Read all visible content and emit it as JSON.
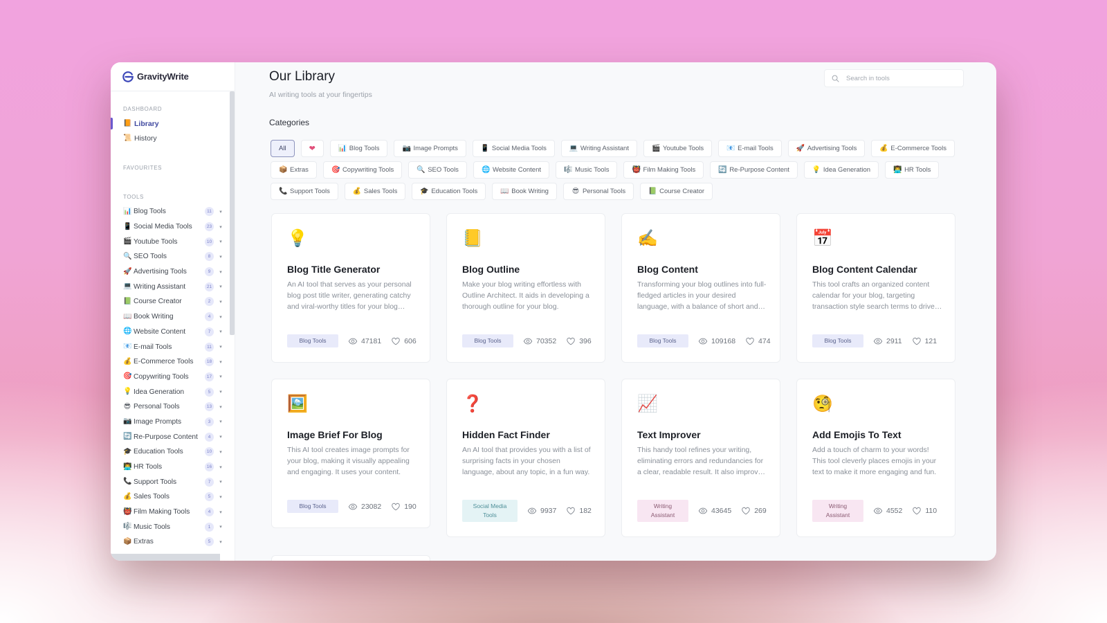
{
  "app": {
    "name": "GravityWrite"
  },
  "sidebar": {
    "dashboard_label": "DASHBOARD",
    "dashboard_items": [
      {
        "label": "Library",
        "emoji": "📙",
        "active": true
      },
      {
        "label": "History",
        "emoji": "📜",
        "active": false
      }
    ],
    "favourites_label": "FAVOURITES",
    "tools_label": "TOOLS",
    "tools": [
      {
        "label": "Blog Tools",
        "emoji": "📊",
        "count": "11"
      },
      {
        "label": "Social Media Tools",
        "emoji": "📱",
        "count": "23"
      },
      {
        "label": "Youtube Tools",
        "emoji": "🎬",
        "count": "10"
      },
      {
        "label": "SEO Tools",
        "emoji": "🔍",
        "count": "8"
      },
      {
        "label": "Advertising Tools",
        "emoji": "🚀",
        "count": "9"
      },
      {
        "label": "Writing Assistant",
        "emoji": "💻",
        "count": "21"
      },
      {
        "label": "Course Creator",
        "emoji": "📗",
        "count": "2"
      },
      {
        "label": "Book Writing",
        "emoji": "📖",
        "count": "4"
      },
      {
        "label": "Website Content",
        "emoji": "🌐",
        "count": "7"
      },
      {
        "label": "E-mail Tools",
        "emoji": "📧",
        "count": "11"
      },
      {
        "label": "E-Commerce Tools",
        "emoji": "💰",
        "count": "18"
      },
      {
        "label": "Copywriting Tools",
        "emoji": "🎯",
        "count": "17"
      },
      {
        "label": "Idea Generation",
        "emoji": "💡",
        "count": "5"
      },
      {
        "label": "Personal Tools",
        "emoji": "😎",
        "count": "13"
      },
      {
        "label": "Image Prompts",
        "emoji": "📷",
        "count": "3"
      },
      {
        "label": "Re-Purpose Content",
        "emoji": "🔄",
        "count": "4"
      },
      {
        "label": "Education Tools",
        "emoji": "🎓",
        "count": "10"
      },
      {
        "label": "HR Tools",
        "emoji": "👨‍💻",
        "count": "16"
      },
      {
        "label": "Support Tools",
        "emoji": "📞",
        "count": "7"
      },
      {
        "label": "Sales Tools",
        "emoji": "💰",
        "count": "5"
      },
      {
        "label": "Film Making Tools",
        "emoji": "👹",
        "count": "4"
      },
      {
        "label": "Music Tools",
        "emoji": "🎼",
        "count": "1"
      },
      {
        "label": "Extras",
        "emoji": "📦",
        "count": "5"
      }
    ]
  },
  "header": {
    "title": "Our Library",
    "subtitle": "AI writing tools at your fingertips",
    "search_placeholder": "Search in tools",
    "search_value": ""
  },
  "categories": {
    "label": "Categories",
    "rows": [
      [
        {
          "label": "All",
          "emoji": "",
          "active": true
        },
        {
          "label": "",
          "emoji": "❤",
          "favourite": true
        },
        {
          "label": "Blog Tools",
          "emoji": "📊"
        },
        {
          "label": "Image Prompts",
          "emoji": "📷"
        },
        {
          "label": "Social Media Tools",
          "emoji": "📱"
        },
        {
          "label": "Writing Assistant",
          "emoji": "💻"
        },
        {
          "label": "Youtube Tools",
          "emoji": "🎬"
        },
        {
          "label": "E-mail Tools",
          "emoji": "📧"
        },
        {
          "label": "Advertising Tools",
          "emoji": "🚀"
        },
        {
          "label": "E-Commerce Tools",
          "emoji": "💰"
        }
      ],
      [
        {
          "label": "Extras",
          "emoji": "📦"
        },
        {
          "label": "Copywriting Tools",
          "emoji": "🎯"
        },
        {
          "label": "SEO Tools",
          "emoji": "🔍"
        },
        {
          "label": "Website Content",
          "emoji": "🌐"
        },
        {
          "label": "Music Tools",
          "emoji": "🎼"
        },
        {
          "label": "Film Making Tools",
          "emoji": "👹"
        },
        {
          "label": "Re-Purpose Content",
          "emoji": "🔄"
        },
        {
          "label": "Idea Generation",
          "emoji": "💡"
        },
        {
          "label": "HR Tools",
          "emoji": "👨‍💻"
        }
      ],
      [
        {
          "label": "Support Tools",
          "emoji": "📞"
        },
        {
          "label": "Sales Tools",
          "emoji": "💰"
        },
        {
          "label": "Education Tools",
          "emoji": "🎓"
        },
        {
          "label": "Book Writing",
          "emoji": "📖"
        },
        {
          "label": "Personal Tools",
          "emoji": "😎"
        },
        {
          "label": "Course Creator",
          "emoji": "📗"
        }
      ]
    ]
  },
  "cards": [
    {
      "icon": "💡",
      "title": "Blog Title Generator",
      "desc": "An AI tool that serves as your personal blog post title writer, generating catchy and viral-worthy titles for your blog posts.",
      "tag": "Blog Tools",
      "tag_type": "blog",
      "views": "47181",
      "likes": "606"
    },
    {
      "icon": "📒",
      "title": "Blog Outline",
      "desc": "Make your blog writing effortless with Outline Architect. It aids in developing a thorough outline for your blog.",
      "tag": "Blog Tools",
      "tag_type": "blog",
      "views": "70352",
      "likes": "396"
    },
    {
      "icon": "✍️",
      "title": "Blog Content",
      "desc": "Transforming your blog outlines into full-fledged articles in your desired language, with a balance of short and long sentences.",
      "tag": "Blog Tools",
      "tag_type": "blog",
      "views": "109168",
      "likes": "474"
    },
    {
      "icon": "📅",
      "title": "Blog Content Calendar",
      "desc": "This tool crafts an organized content calendar for your blog, targeting transaction style search terms to drive traffic.",
      "tag": "Blog Tools",
      "tag_type": "blog",
      "views": "2911",
      "likes": "121"
    },
    {
      "icon": "🖼️",
      "title": "Image Brief For Blog",
      "desc": "This AI tool creates image prompts for your blog, making it visually appealing and engaging. It uses your content.",
      "tag": "Blog Tools",
      "tag_type": "blog",
      "views": "23082",
      "likes": "190"
    },
    {
      "icon": "❓",
      "title": "Hidden Fact Finder",
      "desc": "An AI tool that provides you with a list of surprising facts in your chosen language, about any topic, in a fun way.",
      "tag": "Social Media Tools",
      "tag_type": "social",
      "views": "9937",
      "likes": "182"
    },
    {
      "icon": "📈",
      "title": "Text Improver",
      "desc": "This handy tool refines your writing, eliminating errors and redundancies for a clear, readable result. It also improves flow.",
      "tag": "Writing Assistant",
      "tag_type": "writing",
      "views": "43645",
      "likes": "269"
    },
    {
      "icon": "🧐",
      "title": "Add Emojis To Text",
      "desc": "Add a touch of charm to your words! This tool cleverly places emojis in your text to make it more engaging and fun.",
      "tag": "Writing Assistant",
      "tag_type": "writing",
      "views": "4552",
      "likes": "110"
    }
  ],
  "colors": {
    "accent": "#6a5acd",
    "active_nav_text": "#4049a0",
    "tag_blog_bg": "#e8eafa",
    "tag_social_bg": "#e4f3f5",
    "tag_writing_bg": "#f8e6f2",
    "heart": "#e1507a"
  }
}
